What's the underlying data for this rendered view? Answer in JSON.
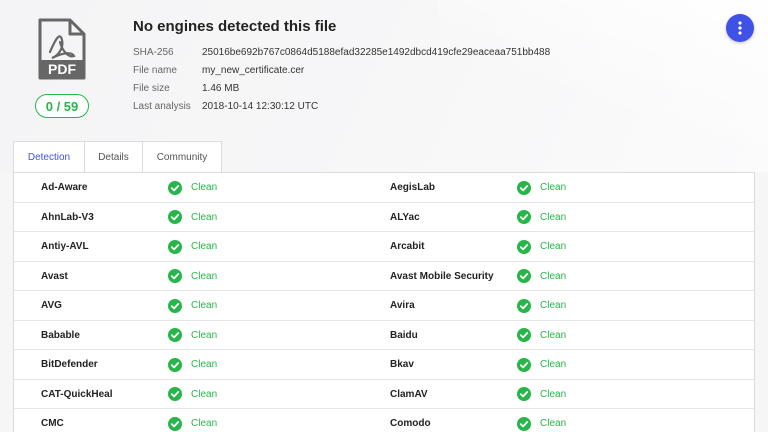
{
  "file": {
    "icon_label": "PDF",
    "score": "0 / 59",
    "title": "No engines detected this file",
    "meta": [
      {
        "key": "SHA-256",
        "value": "25016be692b767c0864d5188efad32285e1492dbcd419cfe29eaceaa751bb488"
      },
      {
        "key": "File name",
        "value": "my_new_certificate.cer"
      },
      {
        "key": "File size",
        "value": "1.46 MB"
      },
      {
        "key": "Last analysis",
        "value": "2018-10-14 12:30:12 UTC"
      }
    ]
  },
  "tabs": [
    {
      "label": "Detection",
      "active": true
    },
    {
      "label": "Details",
      "active": false
    },
    {
      "label": "Community",
      "active": false
    }
  ],
  "detections": [
    [
      {
        "engine": "Ad-Aware",
        "result": "Clean"
      },
      {
        "engine": "AegisLab",
        "result": "Clean"
      }
    ],
    [
      {
        "engine": "AhnLab-V3",
        "result": "Clean"
      },
      {
        "engine": "ALYac",
        "result": "Clean"
      }
    ],
    [
      {
        "engine": "Antiy-AVL",
        "result": "Clean"
      },
      {
        "engine": "Arcabit",
        "result": "Clean"
      }
    ],
    [
      {
        "engine": "Avast",
        "result": "Clean"
      },
      {
        "engine": "Avast Mobile Security",
        "result": "Clean"
      }
    ],
    [
      {
        "engine": "AVG",
        "result": "Clean"
      },
      {
        "engine": "Avira",
        "result": "Clean"
      }
    ],
    [
      {
        "engine": "Babable",
        "result": "Clean"
      },
      {
        "engine": "Baidu",
        "result": "Clean"
      }
    ],
    [
      {
        "engine": "BitDefender",
        "result": "Clean"
      },
      {
        "engine": "Bkav",
        "result": "Clean"
      }
    ],
    [
      {
        "engine": "CAT-QuickHeal",
        "result": "Clean"
      },
      {
        "engine": "ClamAV",
        "result": "Clean"
      }
    ],
    [
      {
        "engine": "CMC",
        "result": "Clean"
      },
      {
        "engine": "Comodo",
        "result": "Clean"
      }
    ]
  ],
  "colors": {
    "accent": "#3f51e6",
    "clean": "#27b649"
  },
  "icons": {
    "file": "pdf-file-icon",
    "menu": "more-vertical-icon",
    "result": "check-circle-icon"
  }
}
